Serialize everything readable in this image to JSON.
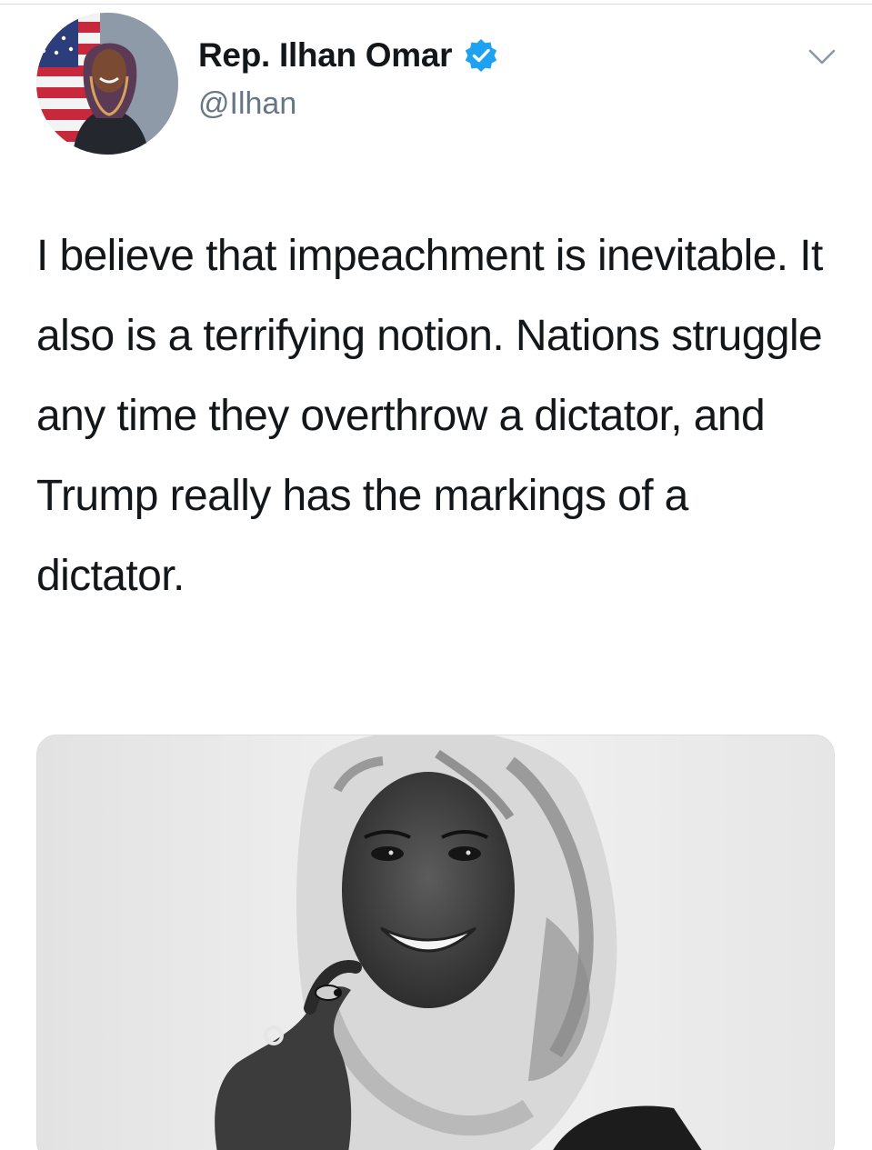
{
  "tweet": {
    "author": {
      "display_name": "Rep. Ilhan Omar",
      "handle": "@Ilhan",
      "verified": true
    },
    "text": "I believe that impeachment is inevitable. It also is a terrifying notion. Nations struggle any time they overthrow a dictator, and Trump really has the markings of a dictator.",
    "media": {
      "type": "photo",
      "style": "black-and-white"
    }
  },
  "icons": {
    "verified": "verified-badge-icon",
    "menu": "chevron-down-icon"
  },
  "colors": {
    "verified_blue": "#1da1f2",
    "text_primary": "#14171a",
    "text_secondary": "#657786"
  }
}
